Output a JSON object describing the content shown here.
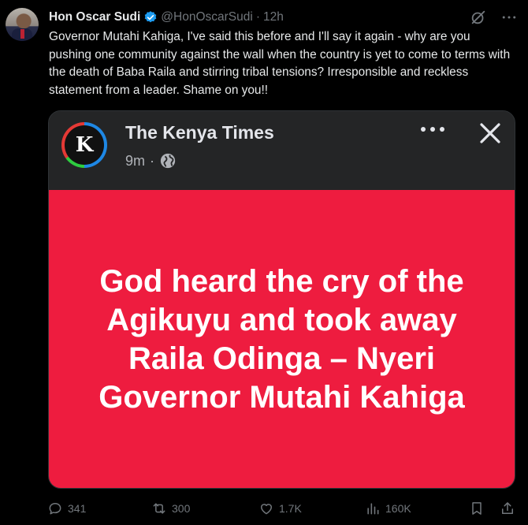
{
  "tweet": {
    "author_name": "Hon Oscar Sudi",
    "handle": "@HonOscarSudi",
    "separator": "·",
    "time": "12h",
    "text": "Governor Mutahi Kahiga, I've said this before and I'll say it again - why are you pushing one community against the wall when the country is yet to come to terms with the death of Baba Raila and stirring tribal tensions? Irresponsible and reckless statement from a leader. Shame on you!!",
    "icons": {
      "verified": "verified-badge-icon",
      "grok": "grok-icon",
      "more": "more-options-icon"
    },
    "colors": {
      "verified": "#1d9bf0",
      "muted": "#71767b"
    }
  },
  "embedded_post": {
    "page_name": "The Kenya Times",
    "time": "9m",
    "separator": "·",
    "logo_letter": "K",
    "quote": "God heard the cry of the Agikuyu and took away Raila Odinga – Nyeri Governor Mutahi Kahiga",
    "colors": {
      "banner": "#ee1c3f",
      "header": "#242526"
    },
    "icons": {
      "globe": "globe-icon",
      "more": "ellipsis-icon",
      "close": "close-icon"
    }
  },
  "actions": {
    "replies": "341",
    "reposts": "300",
    "likes": "1.7K",
    "views": "160K",
    "icons": [
      "reply-icon",
      "repost-icon",
      "like-icon",
      "views-icon",
      "bookmark-icon",
      "share-icon"
    ]
  }
}
